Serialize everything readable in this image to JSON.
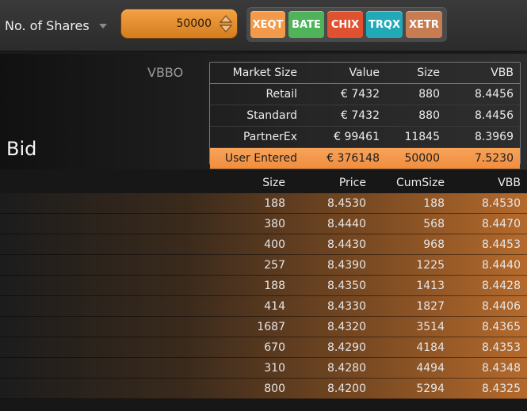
{
  "toolbar": {
    "shares_label": "No. of Shares",
    "quantity_value": "50000",
    "exchanges": [
      {
        "label": "XEQT",
        "color": "#f39a4a"
      },
      {
        "label": "BATE",
        "color": "#4fb35a"
      },
      {
        "label": "CHIX",
        "color": "#e0522f"
      },
      {
        "label": "TRQX",
        "color": "#22a9b8"
      },
      {
        "label": "XETR",
        "color": "#c87c52"
      }
    ]
  },
  "bid": {
    "side_label": "Bid",
    "vbbo_label": "VBBO",
    "market": {
      "headers": [
        "Market Size",
        "Value",
        "Size",
        "VBB"
      ],
      "rows": [
        [
          "Retail",
          "€ 7432",
          "880",
          "8.4456"
        ],
        [
          "Standard",
          "€ 7432",
          "880",
          "8.4456"
        ],
        [
          "PartnerEx",
          "€ 99461",
          "11845",
          "8.3969"
        ]
      ],
      "user_row": [
        "User Entered",
        "€ 376148",
        "50000",
        "7.5230"
      ]
    }
  },
  "depth": {
    "headers": [
      "Size",
      "Price",
      "CumSize",
      "VBB"
    ],
    "rows": [
      [
        "188",
        "8.4530",
        "188",
        "8.4530"
      ],
      [
        "380",
        "8.4440",
        "568",
        "8.4470"
      ],
      [
        "400",
        "8.4430",
        "968",
        "8.4453"
      ],
      [
        "257",
        "8.4390",
        "1225",
        "8.4440"
      ],
      [
        "188",
        "8.4350",
        "1413",
        "8.4428"
      ],
      [
        "414",
        "8.4330",
        "1827",
        "8.4406"
      ],
      [
        "1687",
        "8.4320",
        "3514",
        "8.4365"
      ],
      [
        "670",
        "8.4290",
        "4184",
        "8.4353"
      ],
      [
        "310",
        "8.4280",
        "4494",
        "8.4348"
      ],
      [
        "800",
        "8.4200",
        "5294",
        "8.4325"
      ]
    ]
  }
}
